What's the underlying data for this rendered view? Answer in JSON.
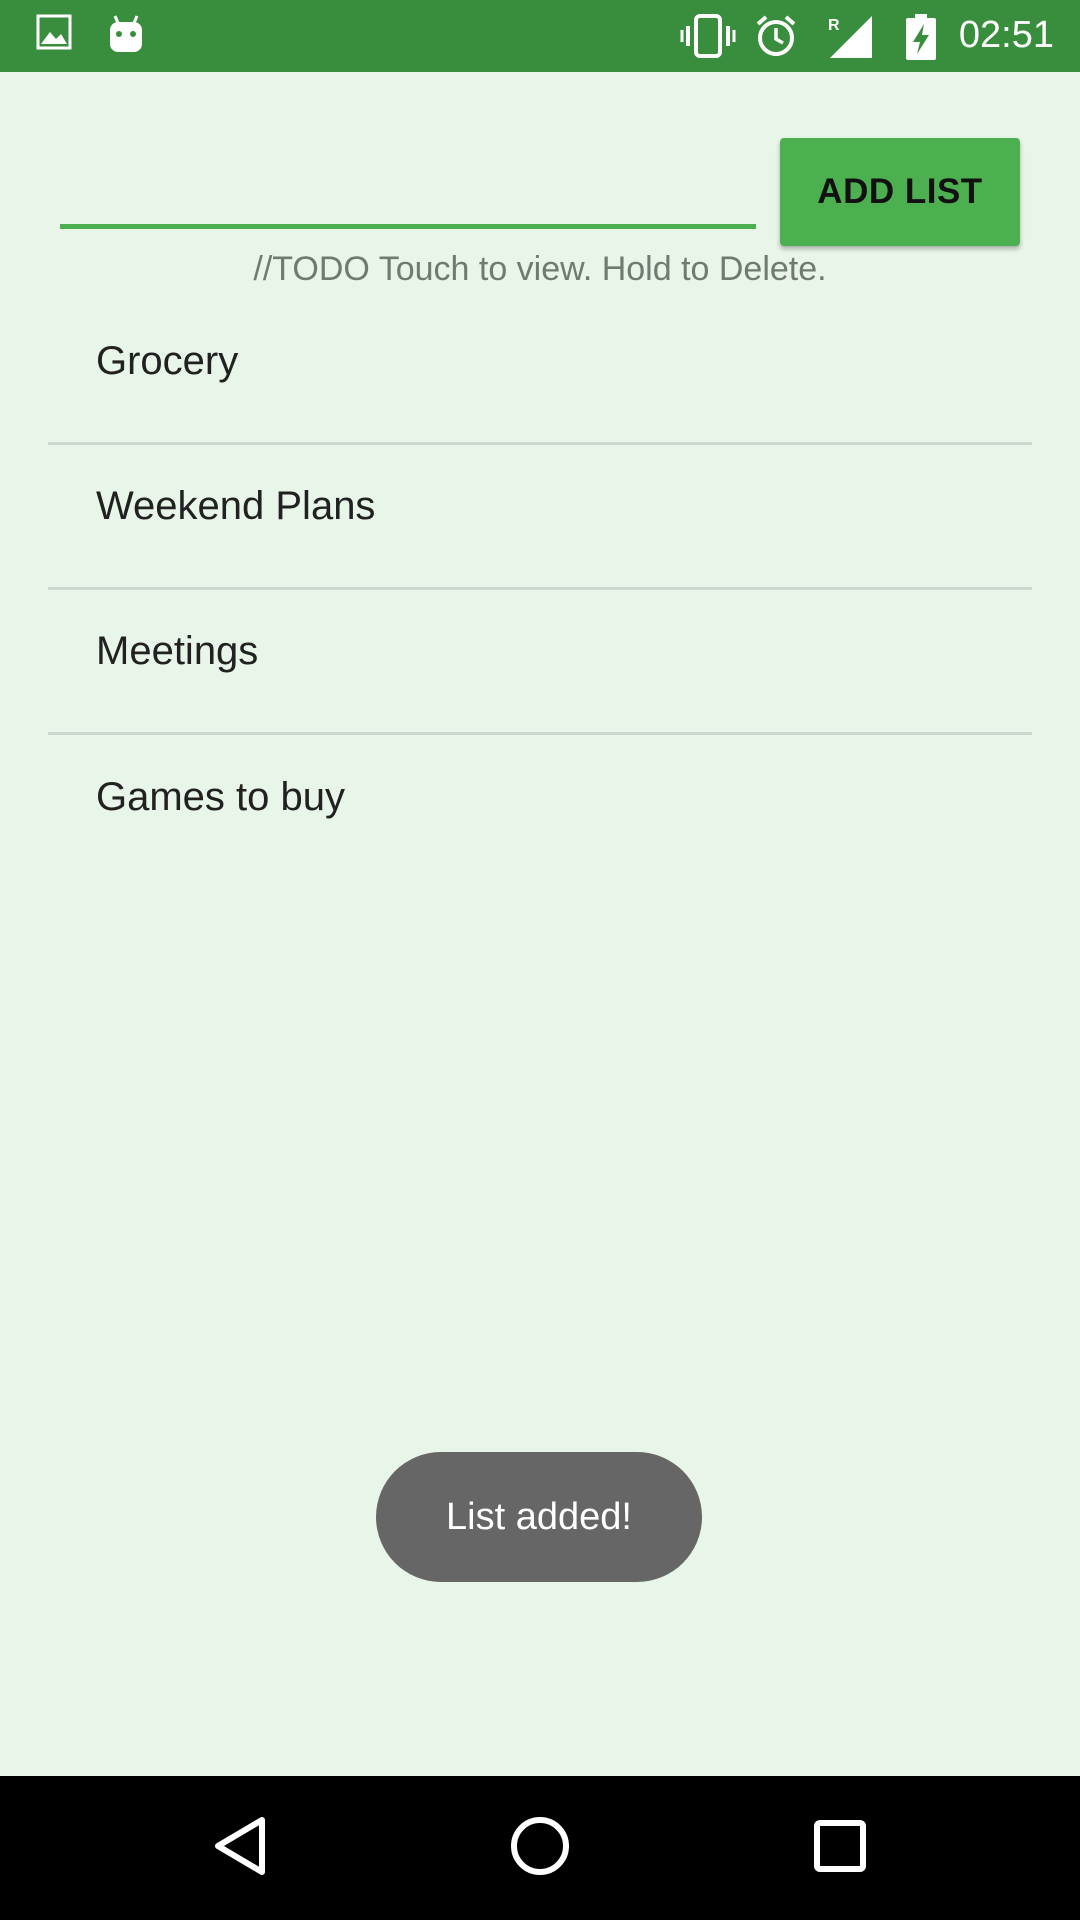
{
  "status_bar": {
    "time": "02:51",
    "icons": [
      "image-icon",
      "android-icon",
      "vibrate-icon",
      "alarm-icon",
      "signal-roaming-icon",
      "battery-charging-icon"
    ],
    "background": "#388e3c"
  },
  "input": {
    "value": "",
    "placeholder": ""
  },
  "add_button": {
    "label": "ADD LIST",
    "color": "#4caf50"
  },
  "hint": "//TODO Touch to view. Hold to Delete.",
  "lists": [
    {
      "label": "Grocery"
    },
    {
      "label": "Weekend Plans"
    },
    {
      "label": "Meetings"
    },
    {
      "label": "Games to buy"
    }
  ],
  "toast": "List added!",
  "nav_bar": {
    "icons": [
      "back-icon",
      "home-icon",
      "recents-icon"
    ]
  },
  "colors": {
    "background": "#e8f5e9",
    "accent": "#4caf50",
    "toast_bg": "#666666"
  }
}
